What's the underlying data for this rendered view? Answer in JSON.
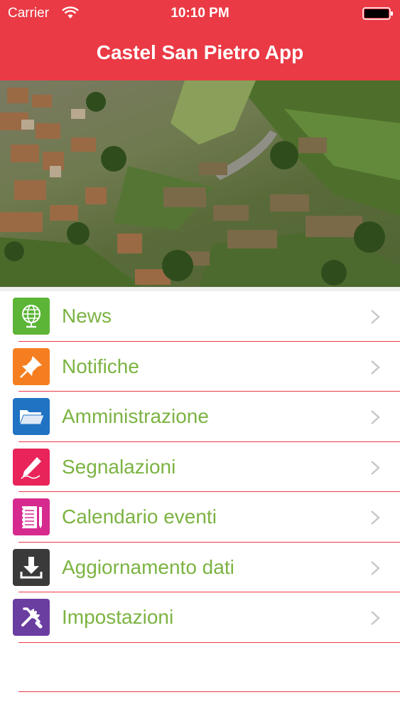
{
  "status_bar": {
    "carrier": "Carrier",
    "time": "10:10 PM"
  },
  "nav": {
    "title": "Castel San Pietro App"
  },
  "colors": {
    "accent": "#ea3a45",
    "label": "#7cb342"
  },
  "menu": {
    "items": [
      {
        "label": "News",
        "icon": "globe-icon",
        "color": "#5cb536"
      },
      {
        "label": "Notifiche",
        "icon": "pin-icon",
        "color": "#f57f20"
      },
      {
        "label": "Amministrazione",
        "icon": "folder-icon",
        "color": "#1f73c2"
      },
      {
        "label": "Segnalazioni",
        "icon": "pencil-icon",
        "color": "#e8245a"
      },
      {
        "label": "Calendario eventi",
        "icon": "notepad-icon",
        "color": "#d62a8f"
      },
      {
        "label": "Aggiornamento dati",
        "icon": "download-icon",
        "color": "#3a3a3a"
      },
      {
        "label": "Impostazioni",
        "icon": "tools-icon",
        "color": "#6a3ea1"
      }
    ]
  }
}
